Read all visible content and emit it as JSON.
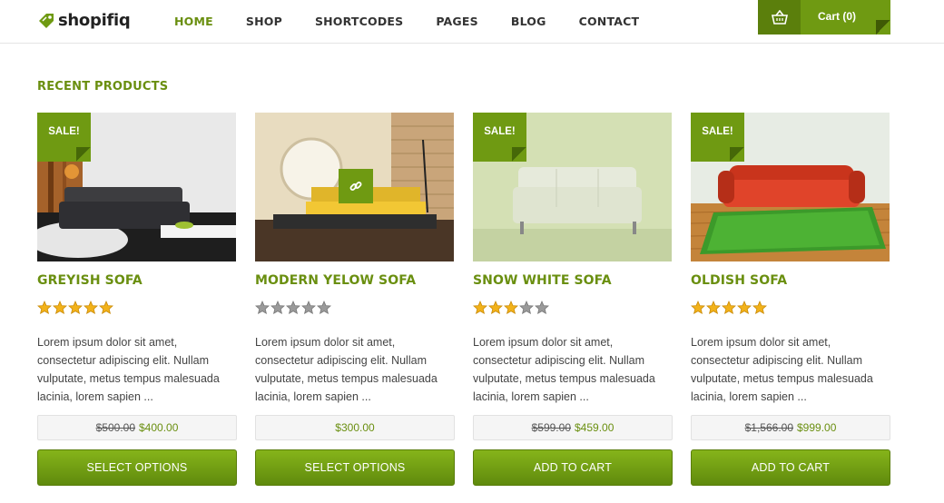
{
  "brand": {
    "name": "shopifiq"
  },
  "nav": {
    "items": [
      "HOME",
      "SHOP",
      "SHORTCODES",
      "PAGES",
      "BLOG",
      "CONTACT"
    ],
    "active": "HOME"
  },
  "cart": {
    "label": "Cart (0)",
    "icon": "basket-icon"
  },
  "section": {
    "title": "RECENT PRODUCTS"
  },
  "products": [
    {
      "name": "GREYISH SOFA",
      "sale_badge": "SALE!",
      "rating": 5,
      "description": "Lorem ipsum dolor sit amet, consectetur adipiscing elit. Nullam vulputate, metus tempus malesuada lacinia, lorem sapien ...",
      "old_price": "$500.00",
      "price": "$400.00",
      "button": "SELECT OPTIONS"
    },
    {
      "name": "MODERN YELOW SOFA",
      "sale_badge": "",
      "rating": 0,
      "description": "Lorem ipsum dolor sit amet, consectetur adipiscing elit. Nullam vulputate, metus tempus malesuada lacinia, lorem sapien ...",
      "old_price": "",
      "price": "$300.00",
      "button": "SELECT OPTIONS"
    },
    {
      "name": "SNOW WHITE SOFA",
      "sale_badge": "SALE!",
      "rating": 3,
      "description": "Lorem ipsum dolor sit amet, consectetur adipiscing elit. Nullam vulputate, metus tempus malesuada lacinia, lorem sapien ...",
      "old_price": "$599.00",
      "price": "$459.00",
      "button": "ADD TO CART"
    },
    {
      "name": "OLDISH SOFA",
      "sale_badge": "SALE!",
      "rating": 5,
      "description": "Lorem ipsum dolor sit amet, consectetur adipiscing elit. Nullam vulputate, metus tempus malesuada lacinia, lorem sapien ...",
      "old_price": "$1,566.00",
      "price": "$999.00",
      "button": "ADD TO CART"
    }
  ],
  "colors": {
    "accent": "#6a8f10",
    "button_top": "#86b41a",
    "button_bottom": "#5f8a0d",
    "star_on": "#f2b21a",
    "star_off": "#9a9a9a"
  }
}
